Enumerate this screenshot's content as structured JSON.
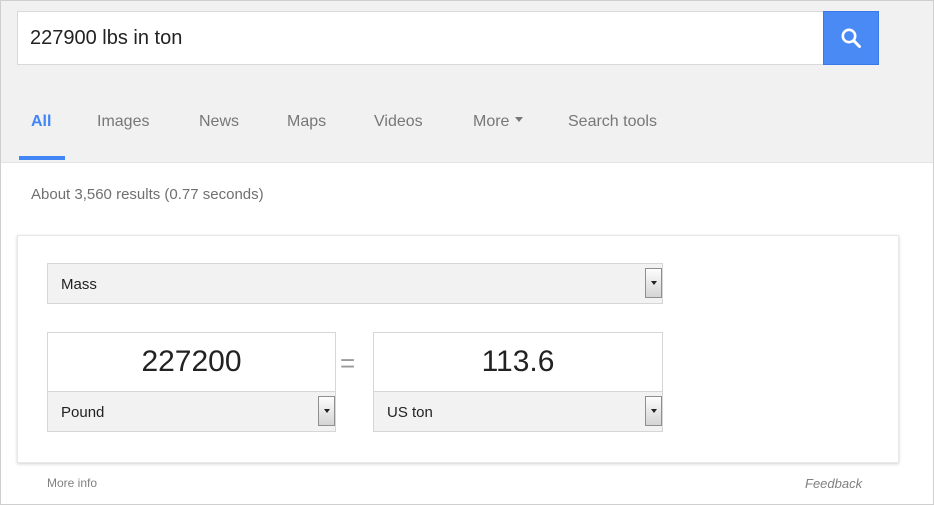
{
  "search": {
    "query": "227900 lbs in ton"
  },
  "nav": {
    "tabs": [
      {
        "label": "All",
        "active": true
      },
      {
        "label": "Images"
      },
      {
        "label": "News"
      },
      {
        "label": "Maps"
      },
      {
        "label": "Videos"
      },
      {
        "label": "More"
      },
      {
        "label": "Search tools"
      }
    ]
  },
  "results": {
    "stats": "About 3,560 results (0.77 seconds)"
  },
  "converter": {
    "category": "Mass",
    "from": {
      "value": "227200",
      "unit": "Pound"
    },
    "equals_sign": "=",
    "to": {
      "value": "113.6",
      "unit": "US ton"
    }
  },
  "footer": {
    "more_info": "More info",
    "feedback": "Feedback"
  },
  "colors": {
    "accent": "#4285f4",
    "search_button": "#4a8af4"
  },
  "icons": {
    "search_button": "search-icon",
    "dropdown": "dropdown-arrow-icon"
  }
}
